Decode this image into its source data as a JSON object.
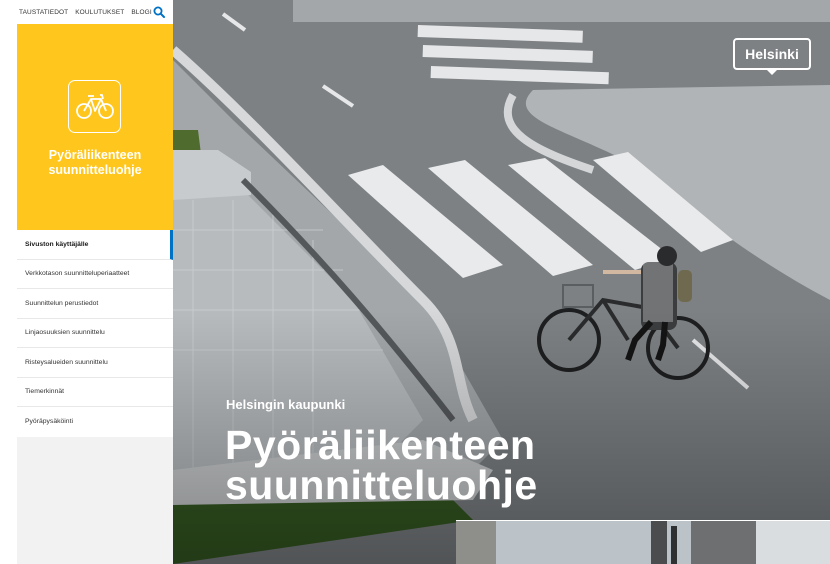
{
  "topnav": {
    "items": [
      "TAUSTATIEDOT",
      "KOULUTUKSET",
      "BLOGI"
    ],
    "search_icon": "search-icon"
  },
  "brand": {
    "title_line1": "Pyöräliikenteen",
    "title_line2": "suunnitteluohje",
    "icon": "bicycle-icon",
    "color": "#ffc61e"
  },
  "menu": {
    "items": [
      {
        "label": "Sivuston käyttäjälle",
        "active": true
      },
      {
        "label": "Verkkotason suunnitteluperiaatteet"
      },
      {
        "label": "Suunnittelun perustiedot"
      },
      {
        "label": "Linjaosuuksien suunnittelu"
      },
      {
        "label": "Risteysalueiden suunnittelu"
      },
      {
        "label": "Tiemerkinnät"
      },
      {
        "label": "Pyöräpysäköinti"
      }
    ],
    "active_color": "#0072c6"
  },
  "hero": {
    "logo_text": "Helsinki",
    "eyebrow": "Helsingin kaupunki",
    "title_line1": "Pyöräliikenteen",
    "title_line2": "suunnitteluohje"
  }
}
